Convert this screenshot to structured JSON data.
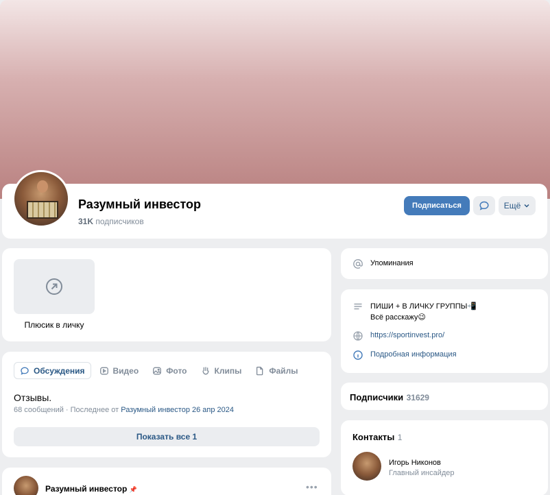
{
  "group": {
    "name": "Разумный инвестор",
    "subscribers_count": "31K",
    "subscribers_label": "подписчиков"
  },
  "actions": {
    "subscribe": "Подписаться",
    "more": "Ещё"
  },
  "plus_tile": {
    "label": "Плюсик в личку"
  },
  "tabs": [
    {
      "label": "Обсуждения",
      "icon": "chat-icon",
      "active": true
    },
    {
      "label": "Видео",
      "icon": "play-icon",
      "active": false
    },
    {
      "label": "Фото",
      "icon": "image-icon",
      "active": false
    },
    {
      "label": "Клипы",
      "icon": "clips-icon",
      "active": false
    },
    {
      "label": "Файлы",
      "icon": "file-icon",
      "active": false
    }
  ],
  "discussion": {
    "title": "Отзывы.",
    "meta_prefix": "68 сообщений · Последнее от",
    "meta_author": "Разумный инвестор",
    "meta_date": "26 апр 2024",
    "show_all": "Показать все 1"
  },
  "post": {
    "author": "Разумный инвестор",
    "pin": "📌",
    "menu": "•••"
  },
  "sidebar": {
    "mentions": "Упоминания",
    "info_line1": "ПИШИ + В ЛИЧКУ ГРУППЫ📲",
    "info_line2": "Всё расскажу😉",
    "website": "https://sportinvest.pro/",
    "details": "Подробная информация",
    "subscribers_title": "Подписчики",
    "subscribers_number": "31629",
    "contacts_title": "Контакты",
    "contacts_count": "1",
    "contact_name": "Игорь Никонов",
    "contact_role": "Главный инсайдер"
  },
  "colors": {
    "accent": "#447bba",
    "link": "#2a5885",
    "muted": "#818c99",
    "background": "#edeef0"
  }
}
